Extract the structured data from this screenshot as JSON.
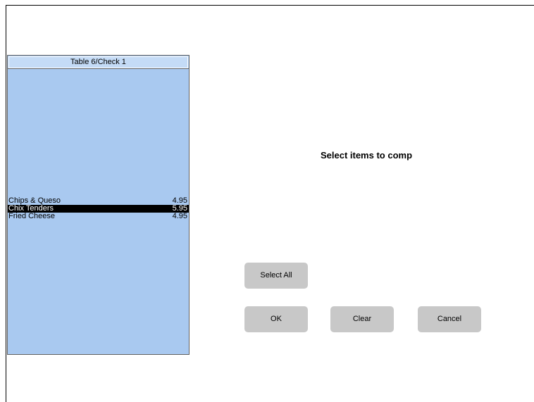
{
  "check": {
    "title": "Table 6/Check 1",
    "items": [
      {
        "name": "Chips & Queso",
        "price": "4.95",
        "selected": false
      },
      {
        "name": "Chix Tenders",
        "price": "5.95",
        "selected": true
      },
      {
        "name": "Fried Cheese",
        "price": "4.95",
        "selected": false
      }
    ]
  },
  "prompt": "Select items to comp",
  "buttons": {
    "select_all": "Select All",
    "ok": "OK",
    "clear": "Clear",
    "cancel": "Cancel"
  },
  "colors": {
    "panel_background": "#a9c9f0",
    "selected_row_background": "#000000",
    "button_background": "#c8c8c8"
  }
}
